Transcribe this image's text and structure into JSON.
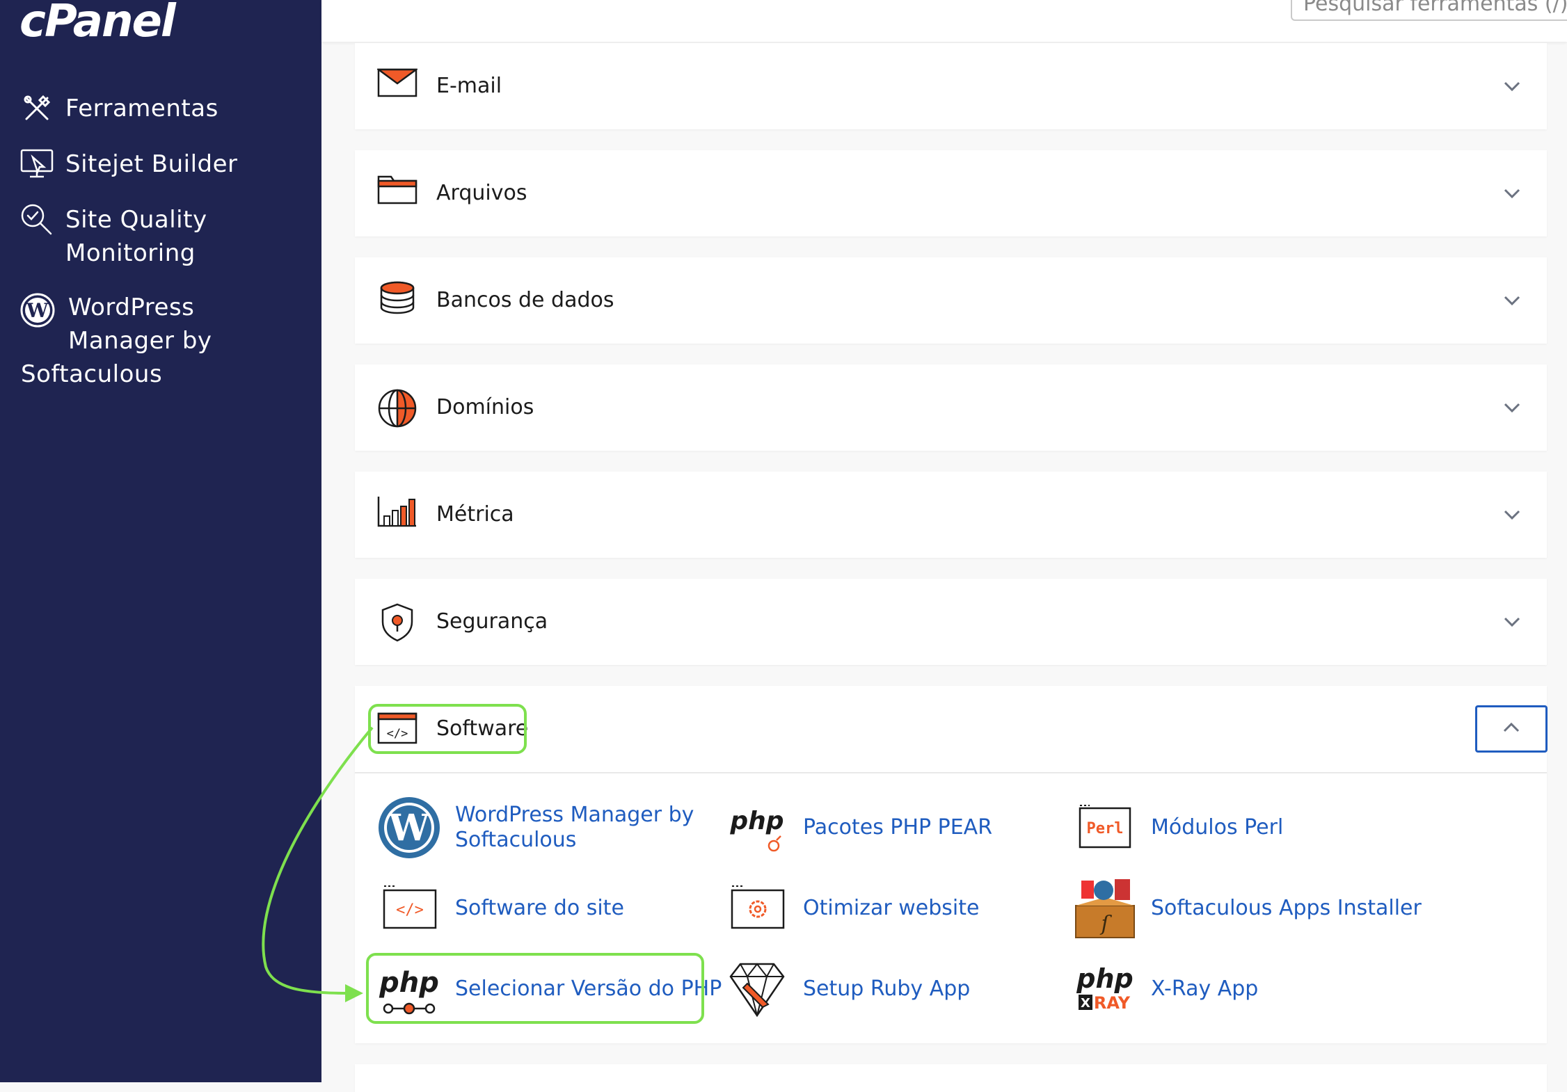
{
  "brand": {
    "logo": "cPanel"
  },
  "sidebar": {
    "items": [
      {
        "label": "Ferramentas",
        "icon": "tools-icon"
      },
      {
        "label": "Sitejet Builder",
        "icon": "sitejet-icon"
      },
      {
        "label": "Site Quality\nMonitoring",
        "icon": "site-quality-icon"
      },
      {
        "label_line1": "WordPress",
        "label_line2": "Manager by",
        "label_line3": "Softaculous",
        "icon": "wordpress-icon"
      }
    ]
  },
  "search": {
    "placeholder": "Pesquisar ferramentas (/)"
  },
  "sections": [
    {
      "title": "E-mail",
      "icon": "email-icon"
    },
    {
      "title": "Arquivos",
      "icon": "folder-icon"
    },
    {
      "title": "Bancos de dados",
      "icon": "database-icon"
    },
    {
      "title": "Domínios",
      "icon": "globe-icon"
    },
    {
      "title": "Métrica",
      "icon": "metrics-icon"
    },
    {
      "title": "Segurança",
      "icon": "shield-icon"
    }
  ],
  "software": {
    "title": "Software",
    "icon": "code-window-icon",
    "tools": [
      {
        "label": "WordPress Manager by\nSoftaculous",
        "icon": "wordpress-icon"
      },
      {
        "label": "Pacotes PHP PEAR",
        "icon": "php-pear-icon"
      },
      {
        "label": "Módulos Perl",
        "icon": "perl-icon"
      },
      {
        "label": "Software do site",
        "icon": "site-software-icon"
      },
      {
        "label": "Otimizar website",
        "icon": "optimize-icon"
      },
      {
        "label": "Softaculous Apps Installer",
        "icon": "softaculous-icon"
      },
      {
        "label": "Selecionar Versão do PHP",
        "icon": "php-version-icon"
      },
      {
        "label": "Setup Ruby App",
        "icon": "ruby-icon"
      },
      {
        "label": "X-Ray App",
        "icon": "xray-icon"
      }
    ]
  },
  "icon_text": {
    "php": "php",
    "perl": "Perl",
    "xray": "RAY",
    "x": "X",
    "code": "</>",
    "w": "W"
  },
  "colors": {
    "sidebar": "#1f2451",
    "accent_orange": "#f05a28",
    "link_blue": "#1f5cbf",
    "highlight_green": "#7ee04e"
  }
}
